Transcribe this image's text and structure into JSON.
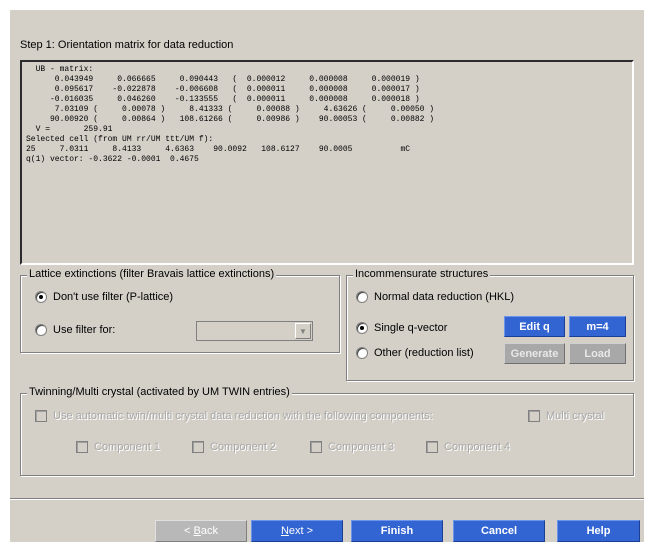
{
  "step_title": "Step 1: Orientation matrix for data reduction",
  "matrix_text": "  UB - matrix:\n      0.043949     0.066665     0.090443   (  0.000012     0.000008     0.000019 )\n      0.095617    -0.022878    -0.006608   (  0.000011     0.000008     0.000017 )\n     -0.016035     0.046260    -0.133555   (  0.000011     0.000008     0.000018 )\n      7.03109 (     0.00078 )     8.41333 (     0.00088 )     4.63626 (     0.00050 )\n     90.00920 (     0.00864 )   108.61266 (     0.00986 )    90.00053 (     0.00882 )\n  V =       259.91\nSelected cell (from UM rr/UM ttt/UM f):\n25     7.0311     8.4133     4.6363    90.0092   108.6127    90.0005          mC\nq(1) vector: -0.3622 -0.0001  0.4675",
  "lattice": {
    "legend": "Lattice extinctions (filter Bravais lattice extinctions)",
    "opt_no_filter": "Don't use filter (P-lattice)",
    "opt_use_filter": "Use filter for:",
    "selected": "no_filter"
  },
  "incomm": {
    "legend": "Incommensurate structures",
    "opt_normal": "Normal data reduction (HKL)",
    "opt_single": "Single q-vector",
    "opt_other": "Other (reduction list)",
    "selected": "single",
    "edit_q": "Edit q",
    "m4": "m=4",
    "generate": "Generate",
    "load": "Load"
  },
  "twin": {
    "legend": "Twinning/Multi crystal (activated by UM TWIN entries)",
    "auto_label": "Use automatic twin/multi crystal data reduction with the following components:",
    "multi": "Multi crystal",
    "components": [
      "Component 1",
      "Component 2",
      "Component 3",
      "Component 4"
    ]
  },
  "nav": {
    "back_u": "B",
    "back_rest": "ack",
    "back_prefix": "< ",
    "next_u": "N",
    "next_rest": "ext >",
    "finish": "Finish",
    "cancel": "Cancel",
    "help": "Help"
  }
}
